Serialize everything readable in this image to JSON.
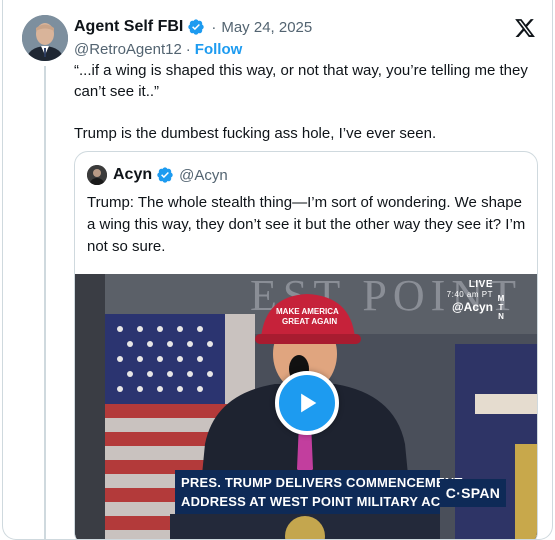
{
  "tweet": {
    "author_name": "Agent Self FBI",
    "dot": "·",
    "date": "May 24, 2025",
    "handle": "@RetroAgent12",
    "separator": "·",
    "follow_label": "Follow",
    "text_line1": "“...if a wing is shaped this way, or not that way, you’re telling me they can’t see it..”",
    "text_line2": "Trump is the dumbest fucking ass hole, I’ve ever seen."
  },
  "quote": {
    "author_name": "Acyn",
    "handle": "@Acyn",
    "text": "Trump: The whole stealth thing—I’m sort of wondering. We shape a wing this way, they don’t see it but the other way they see it? I’m not so sure."
  },
  "video": {
    "live_label": "LIVE",
    "live_time": "7:40 am PT",
    "watermark": "@Acyn",
    "network_vertical": [
      "M",
      "T",
      "N"
    ],
    "chyron_line1": "PRES. TRUMP DELIVERS COMMENCEMENT",
    "chyron_line2": "ADDRESS AT WEST POINT MILITARY ACADEMY",
    "network_logo": "C·SPAN",
    "backdrop_text": "EST POINT",
    "hat_text_line1": "MAKE AMERICA",
    "hat_text_line2": "GREAT AGAIN"
  },
  "icons": {
    "verified": "verified-badge-icon",
    "x_logo": "x-logo-icon",
    "play": "play-icon"
  },
  "colors": {
    "accent": "#1d9bf0",
    "secondary_text": "#536471",
    "border": "#cfd9de",
    "chyron_bg": "#0e2a57"
  }
}
